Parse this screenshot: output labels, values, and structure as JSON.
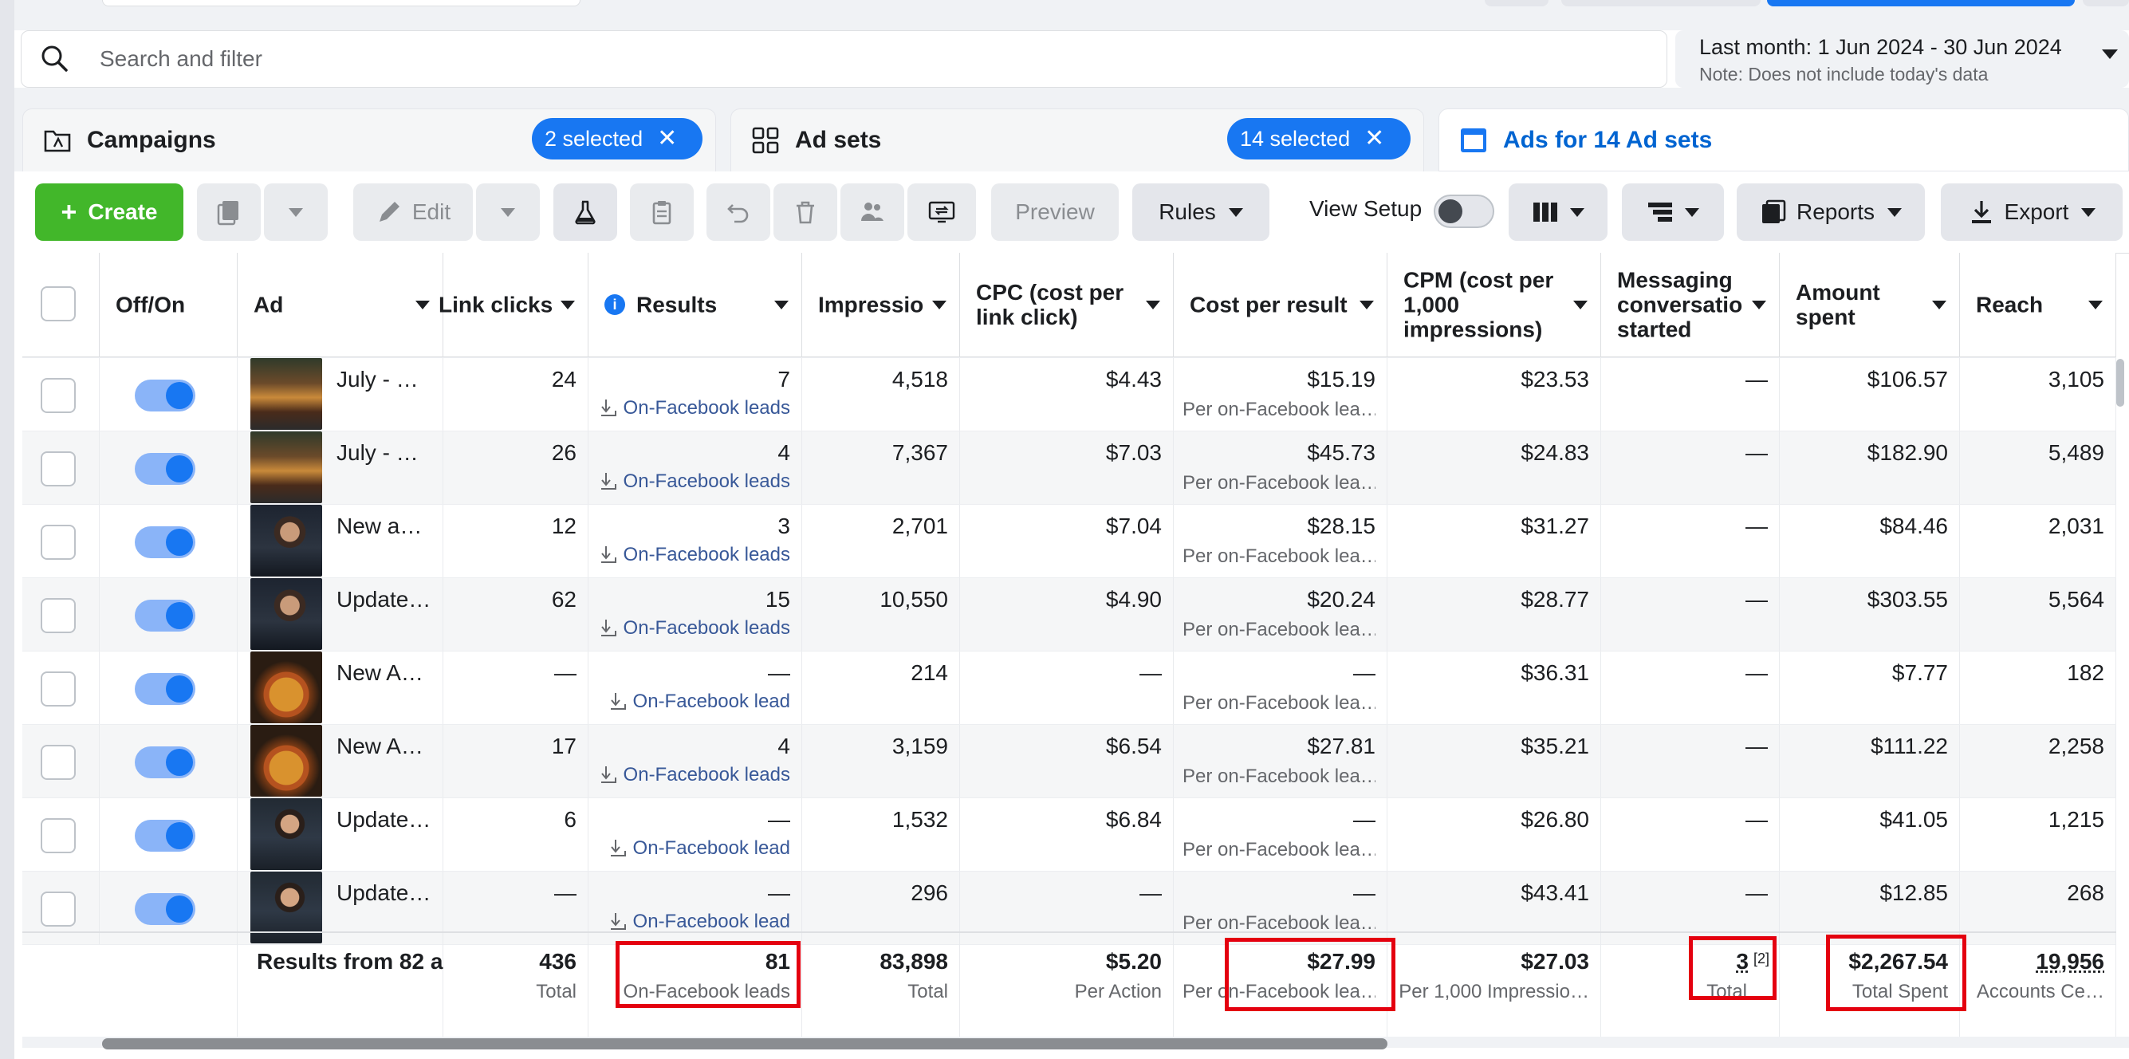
{
  "search": {
    "placeholder": "Search and filter"
  },
  "date_range": {
    "label": "Last month: 1 Jun 2024 - 30 Jun 2024",
    "note": "Note: Does not include today's data"
  },
  "tabs": [
    {
      "label": "Campaigns",
      "badge": "2 selected"
    },
    {
      "label": "Ad sets",
      "badge": "14 selected"
    },
    {
      "label": "Ads for 14 Ad sets"
    }
  ],
  "toolbar": {
    "create": "Create",
    "edit": "Edit",
    "preview": "Preview",
    "rules": "Rules",
    "view_setup": "View Setup",
    "reports": "Reports",
    "export": "Export"
  },
  "columns": {
    "off_on": "Off/On",
    "ad": "Ad",
    "link_clicks": "Link clicks",
    "results": "Results",
    "impressions": "Impressio",
    "cpc": "CPC (cost per link click)",
    "cost_per_result": "Cost per result",
    "cpm": "CPM (cost per 1,000 impressions)",
    "messaging": "Messaging conversations started",
    "amount_spent": "Amount spent",
    "reach": "Reach"
  },
  "rows": [
    {
      "ad": "July - …",
      "link_clicks": "24",
      "results": "7",
      "result_type": "On-Facebook leads",
      "impressions": "4,518",
      "cpc": "$4.43",
      "cost_per_result": "$15.19",
      "cpr_sub": "Per on-Facebook lea…",
      "cpm": "$23.53",
      "messaging": "—",
      "amount_spent": "$106.57",
      "reach": "3,105"
    },
    {
      "ad": "July - …",
      "link_clicks": "26",
      "results": "4",
      "result_type": "On-Facebook leads",
      "impressions": "7,367",
      "cpc": "$7.03",
      "cost_per_result": "$45.73",
      "cpr_sub": "Per on-Facebook lea…",
      "cpm": "$24.83",
      "messaging": "—",
      "amount_spent": "$182.90",
      "reach": "5,489"
    },
    {
      "ad": "New a…",
      "link_clicks": "12",
      "results": "3",
      "result_type": "On-Facebook leads",
      "impressions": "2,701",
      "cpc": "$7.04",
      "cost_per_result": "$28.15",
      "cpr_sub": "Per on-Facebook lea…",
      "cpm": "$31.27",
      "messaging": "—",
      "amount_spent": "$84.46",
      "reach": "2,031"
    },
    {
      "ad": "Update…",
      "link_clicks": "62",
      "results": "15",
      "result_type": "On-Facebook leads",
      "impressions": "10,550",
      "cpc": "$4.90",
      "cost_per_result": "$20.24",
      "cpr_sub": "Per on-Facebook lea…",
      "cpm": "$28.77",
      "messaging": "—",
      "amount_spent": "$303.55",
      "reach": "5,564"
    },
    {
      "ad": "New A…",
      "link_clicks": "—",
      "results": "—",
      "result_type": "On-Facebook lead",
      "impressions": "214",
      "cpc": "—",
      "cost_per_result": "—",
      "cpr_sub": "Per on-Facebook lea…",
      "cpm": "$36.31",
      "messaging": "—",
      "amount_spent": "$7.77",
      "reach": "182"
    },
    {
      "ad": "New A…",
      "link_clicks": "17",
      "results": "4",
      "result_type": "On-Facebook leads",
      "impressions": "3,159",
      "cpc": "$6.54",
      "cost_per_result": "$27.81",
      "cpr_sub": "Per on-Facebook lea…",
      "cpm": "$35.21",
      "messaging": "—",
      "amount_spent": "$111.22",
      "reach": "2,258"
    },
    {
      "ad": "Update…",
      "link_clicks": "6",
      "results": "—",
      "result_type": "On-Facebook lead",
      "impressions": "1,532",
      "cpc": "$6.84",
      "cost_per_result": "—",
      "cpr_sub": "Per on-Facebook lea…",
      "cpm": "$26.80",
      "messaging": "—",
      "amount_spent": "$41.05",
      "reach": "1,215"
    },
    {
      "ad": "Update…",
      "link_clicks": "—",
      "results": "—",
      "result_type": "On-Facebook lead",
      "impressions": "296",
      "cpc": "—",
      "cost_per_result": "—",
      "cpr_sub": "Per on-Facebook lea…",
      "cpm": "$43.41",
      "messaging": "—",
      "amount_spent": "$12.85",
      "reach": "268"
    }
  ],
  "totals": {
    "label": "Results from 82 a",
    "link_clicks": "436",
    "link_clicks_sub": "Total",
    "results": "81",
    "results_sub": "On-Facebook leads",
    "impressions": "83,898",
    "impressions_sub": "Total",
    "cpc": "$5.20",
    "cpc_sub": "Per Action",
    "cost_per_result": "$27.99",
    "cpr_sub": "Per on-Facebook lea…",
    "cpm": "$27.03",
    "cpm_sub": "Per 1,000 Impressio…",
    "messaging": "3",
    "messaging_note": "[2]",
    "messaging_sub": "Total",
    "amount_spent": "$2,267.54",
    "amount_spent_sub": "Total Spent",
    "reach": "19,956",
    "reach_sub": "Accounts Ce…"
  },
  "colors": {
    "accent": "#1877f2",
    "create_green": "#42b72a",
    "highlight_red": "#e4000f",
    "link_blue": "#385898"
  },
  "thumb_themes": [
    "burger",
    "burger",
    "person-dark",
    "person-dark",
    "pizza",
    "pizza",
    "person-suit",
    "person-suit"
  ]
}
